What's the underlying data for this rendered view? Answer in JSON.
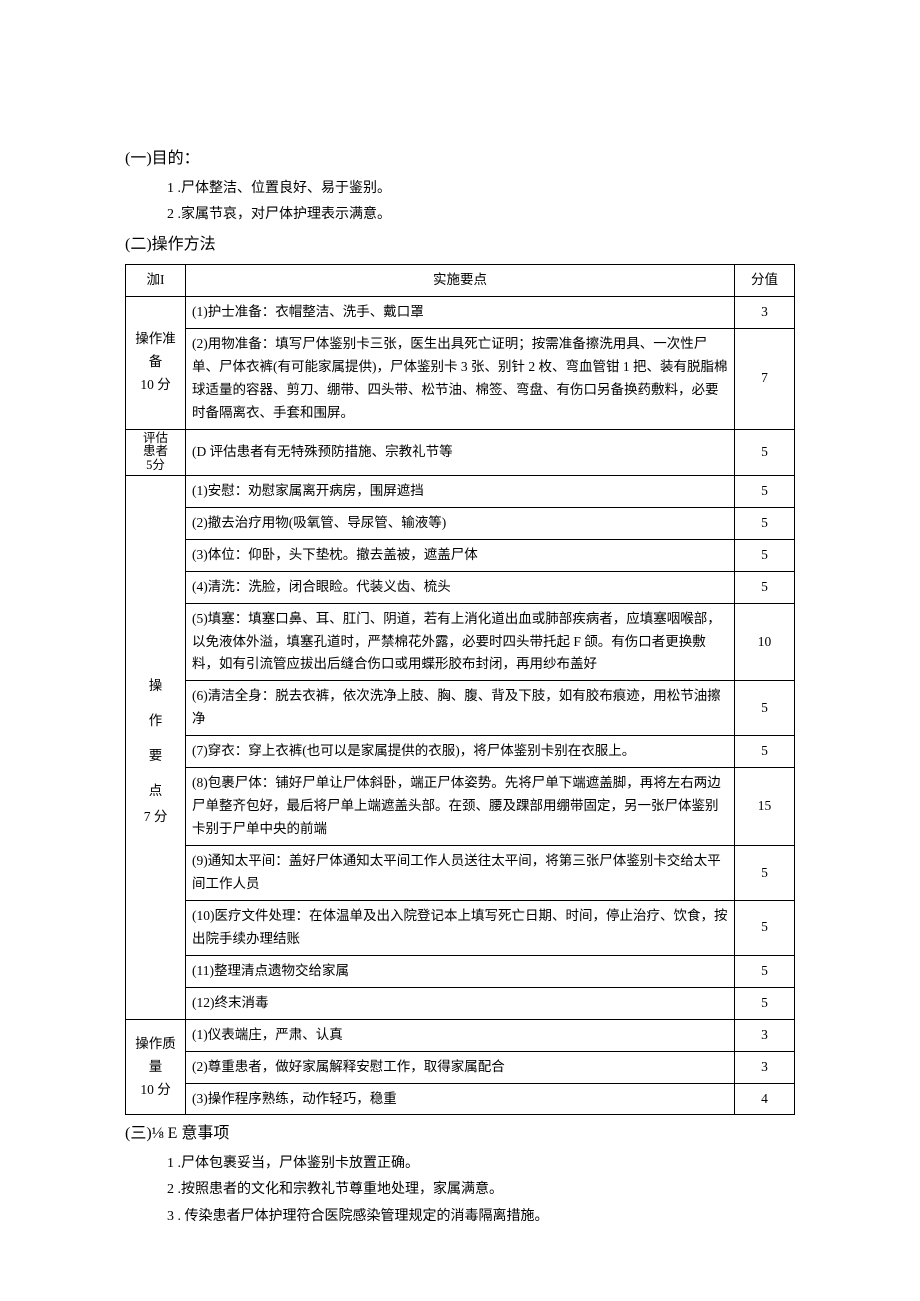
{
  "sections": {
    "one": {
      "heading": "(一)目的：",
      "items": [
        "1 .尸体整洁、位置良好、易于鉴别。",
        "2 .家属节哀，对尸体护理表示满意。"
      ]
    },
    "two": {
      "heading": "(二)操作方法",
      "table": {
        "headers": {
          "col1": "泇I",
          "col2": "实施要点",
          "col3": "分值"
        },
        "rows": [
          {
            "category": "操作准备\n10 分",
            "rowspan": 2,
            "items": [
              {
                "text": "(1)护士准备：衣帽整洁、洗手、戴口罩",
                "score": "3"
              },
              {
                "text": "(2)用物准备：填写尸体鉴别卡三张，医生出具死亡证明；按需准备擦洗用具、一次性尸单、尸体衣裤(有可能家属提供)，尸体鉴别卡 3 张、别针 2 枚、弯血管钳 1 把、装有脱脂棉球适量的容器、剪刀、绷带、四头带、松节油、棉签、弯盘、有伤口另备换药敷料，必要时备隔离衣、手套和围屏。",
                "score": "7"
              }
            ]
          },
          {
            "category": "评估\n患者\n5分",
            "rowspan": 1,
            "compact": true,
            "items": [
              {
                "text": "(D 评估患者有无特殊预防措施、宗教礼节等",
                "score": "5"
              }
            ]
          },
          {
            "category": "操\n\n作\n\n要\n\n点\n\n7 分",
            "rowspan": 12,
            "spaced": true,
            "items": [
              {
                "text": "(1)安慰：劝慰家属离开病房，围屏遮挡",
                "score": "5"
              },
              {
                "text": "(2)撤去治疗用物(吸氧管、导尿管、输液等)",
                "score": "5"
              },
              {
                "text": "(3)体位：仰卧，头下垫枕。撤去盖被，遮盖尸体",
                "score": "5"
              },
              {
                "text": "(4)清洗：洗脸，闭合眼睑。代装义齿、梳头",
                "score": "5"
              },
              {
                "text": "(5)填塞：填塞口鼻、耳、肛门、阴道，若有上消化道出血或肺部疾病者，应填塞咽喉部，以免液体外溢，填塞孔道时，严禁棉花外露，必要时四头带托起 F 颌。有伤口者更换敷料，如有引流管应拔出后缝合伤口或用蝶形胶布封闭，再用纱布盖好",
                "score": "10"
              },
              {
                "text": "(6)清洁全身：脱去衣裤，依次洗净上肢、胸、腹、背及下肢，如有胶布痕迹，用松节油擦净",
                "score": "5"
              },
              {
                "text": "(7)穿衣：穿上衣裤(也可以是家属提供的衣服)，将尸体鉴别卡别在衣服上。",
                "score": "5"
              },
              {
                "text": "(8)包裹尸体：铺好尸单让尸体斜卧，端正尸体姿势。先将尸单下端遮盖脚，再将左右两边尸单整齐包好，最后将尸单上端遮盖头部。在颈、腰及踝部用绷带固定，另一张尸体鉴别卡别于尸单中央的前端",
                "score": "15"
              },
              {
                "text": "(9)通知太平间：盖好尸体通知太平间工作人员送往太平间，将第三张尸体鉴别卡交给太平间工作人员",
                "score": "5"
              },
              {
                "text": "(10)医疗文件处理：在体温单及出入院登记本上填写死亡日期、时间，停止治疗、饮食，按出院手续办理结账",
                "score": "5"
              },
              {
                "text": "(11)整理清点遗物交给家属",
                "score": "5"
              },
              {
                "text": "(12)终末消毒",
                "score": "5"
              }
            ]
          },
          {
            "category": "操作质量\n10 分",
            "rowspan": 3,
            "items": [
              {
                "text": "(1)仪表端庄，严肃、认真",
                "score": "3"
              },
              {
                "text": "(2)尊重患者，做好家属解释安慰工作，取得家属配合",
                "score": "3"
              },
              {
                "text": "(3)操作程序熟练，动作轻巧，稳重",
                "score": "4"
              }
            ]
          }
        ]
      }
    },
    "three": {
      "heading": "(三)⅛ E 意事项",
      "items": [
        "1 .尸体包裹妥当，尸体鉴别卡放置正确。",
        "2 .按照患者的文化和宗教礼节尊重地处理，家属满意。",
        "3 . 传染患者尸体护理符合医院感染管理规定的消毒隔离措施。"
      ]
    }
  }
}
